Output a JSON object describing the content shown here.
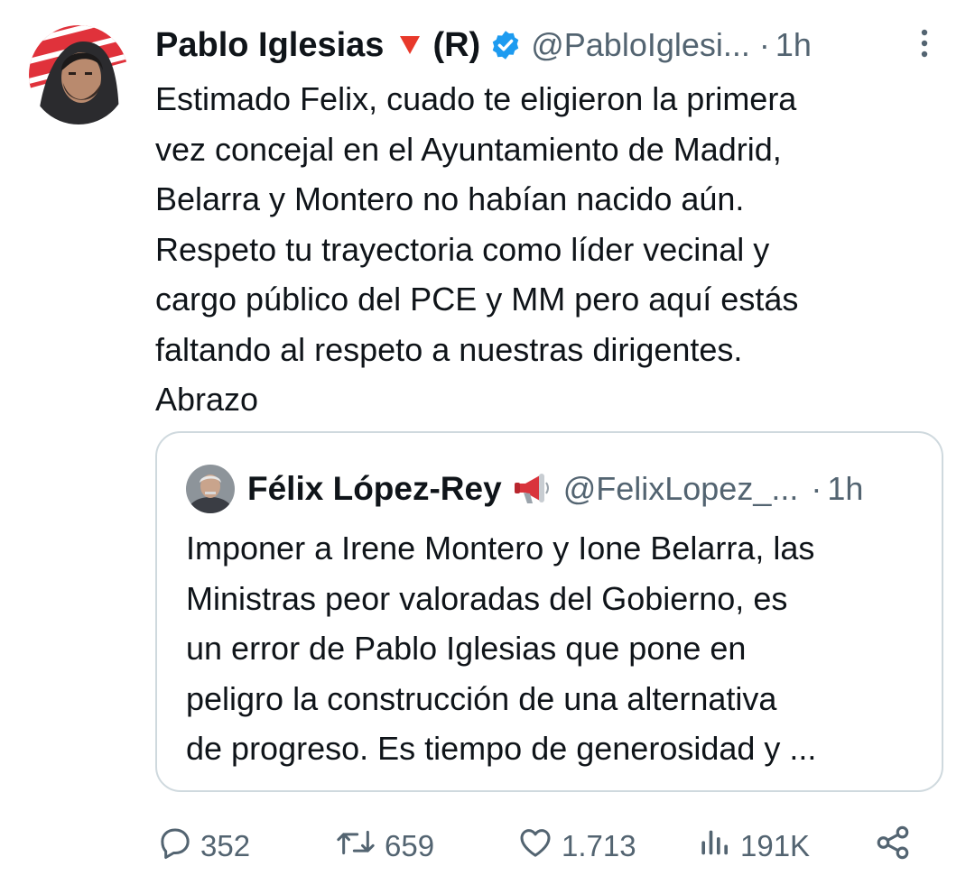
{
  "tweet": {
    "author_name": "Pablo Iglesias",
    "author_suffix": "(R)",
    "handle": "@PabloIglesi...",
    "separator": "·",
    "time": "1h",
    "text_lines": [
      "Estimado Felix, cuado te eligieron la primera",
      "vez concejal en el Ayuntamiento de Madrid,",
      "Belarra y Montero no habían nacido aún.",
      "Respeto tu trayectoria como líder vecinal y",
      "cargo público del PCE y MM pero aquí estás",
      "faltando al respeto a nuestras dirigentes.",
      "Abrazo"
    ]
  },
  "quoted_tweet": {
    "author_name": "Félix López-Rey",
    "handle": "@FelixLopez_...",
    "separator": "·",
    "time": "1h",
    "text_lines": [
      "Imponer a Irene Montero y Ione Belarra, las",
      "Ministras peor valoradas del Gobierno, es",
      "un error de Pablo Iglesias que pone en",
      "peligro la construcción de una alternativa",
      "de progreso. Es tiempo de generosidad y ..."
    ]
  },
  "actions": {
    "replies": "352",
    "reposts": "659",
    "likes": "1.713",
    "views": "191K"
  },
  "icons": {
    "triangle": "red-triangle-icon",
    "verified": "verified-badge-icon",
    "megaphone": "megaphone-icon",
    "more": "more-vertical-icon",
    "reply": "reply-icon",
    "repost": "repost-icon",
    "like": "heart-icon",
    "views": "views-icon",
    "share": "share-icon"
  },
  "colors": {
    "text": "#0f1419",
    "secondary": "#536471",
    "verified": "#1d9bf0",
    "triangle": "#e8392b",
    "border": "#cfd9de"
  }
}
